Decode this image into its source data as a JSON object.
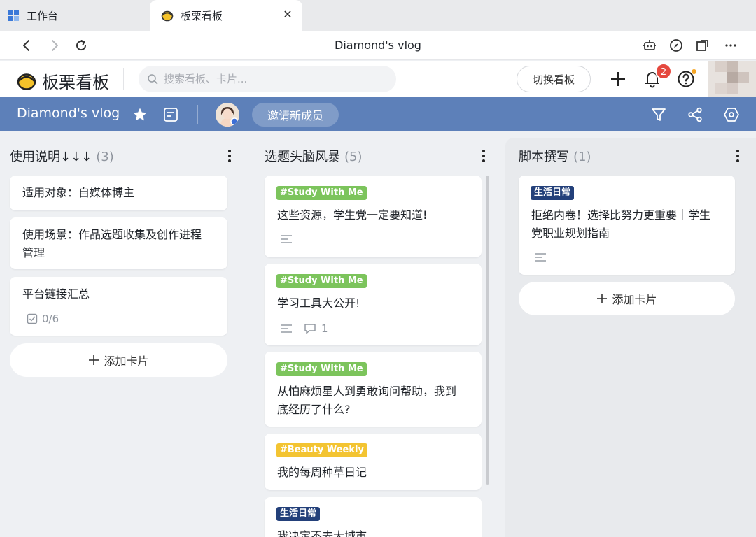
{
  "browser": {
    "tabs": [
      {
        "label": "工作台"
      },
      {
        "label": "板栗看板"
      }
    ],
    "page_title": "Diamond's vlog"
  },
  "header": {
    "logo_text": "板栗看板",
    "search_placeholder": "搜索看板、卡片...",
    "switch_label": "切换看板",
    "notification_count": "2"
  },
  "board": {
    "title": "Diamond's vlog",
    "invite_label": "邀请新成员"
  },
  "columns": [
    {
      "title": "使用说明↓↓↓",
      "count": "(3)",
      "cards": [
        {
          "title": "适用对象：自媒体博主"
        },
        {
          "title_lines": [
            "使用场景：作品选题收集及创作进程",
            "管理"
          ]
        },
        {
          "title": "平台链接汇总",
          "checklist": "0/6"
        }
      ],
      "add_label": "添加卡片"
    },
    {
      "title": "选题头脑风暴",
      "count": "(5)",
      "cards": [
        {
          "tag": "#Study With Me",
          "tag_color": "#7cc45c",
          "title": "这些资源，学生党一定要知道!"
        },
        {
          "tag": "#Study With Me",
          "tag_color": "#7cc45c",
          "title": "学习工具大公开!",
          "comments": "1"
        },
        {
          "tag": "#Study With Me",
          "tag_color": "#7cc45c",
          "title_lines": [
            "从怕麻烦星人到勇敢询问帮助，我到",
            "底经历了什么?"
          ]
        },
        {
          "tag": "#Beauty Weekly",
          "tag_color": "#f3c432",
          "title": "我的每周种草日记"
        },
        {
          "tag": "生活日常",
          "tag_color": "#23407a",
          "title": "我决定不去大城市"
        }
      ]
    },
    {
      "title": "脚本撰写",
      "count": "(1)",
      "cards": [
        {
          "tag": "生活日常",
          "tag_color": "#23407a",
          "title_lines": [
            "拒绝内卷！选择比努力更重要｜学生",
            "党职业规划指南"
          ]
        }
      ],
      "add_label": "添加卡片"
    }
  ],
  "colors": {
    "board_bar": "#5d80b9",
    "background": "#eef0f3",
    "badge": "#e5483e"
  }
}
